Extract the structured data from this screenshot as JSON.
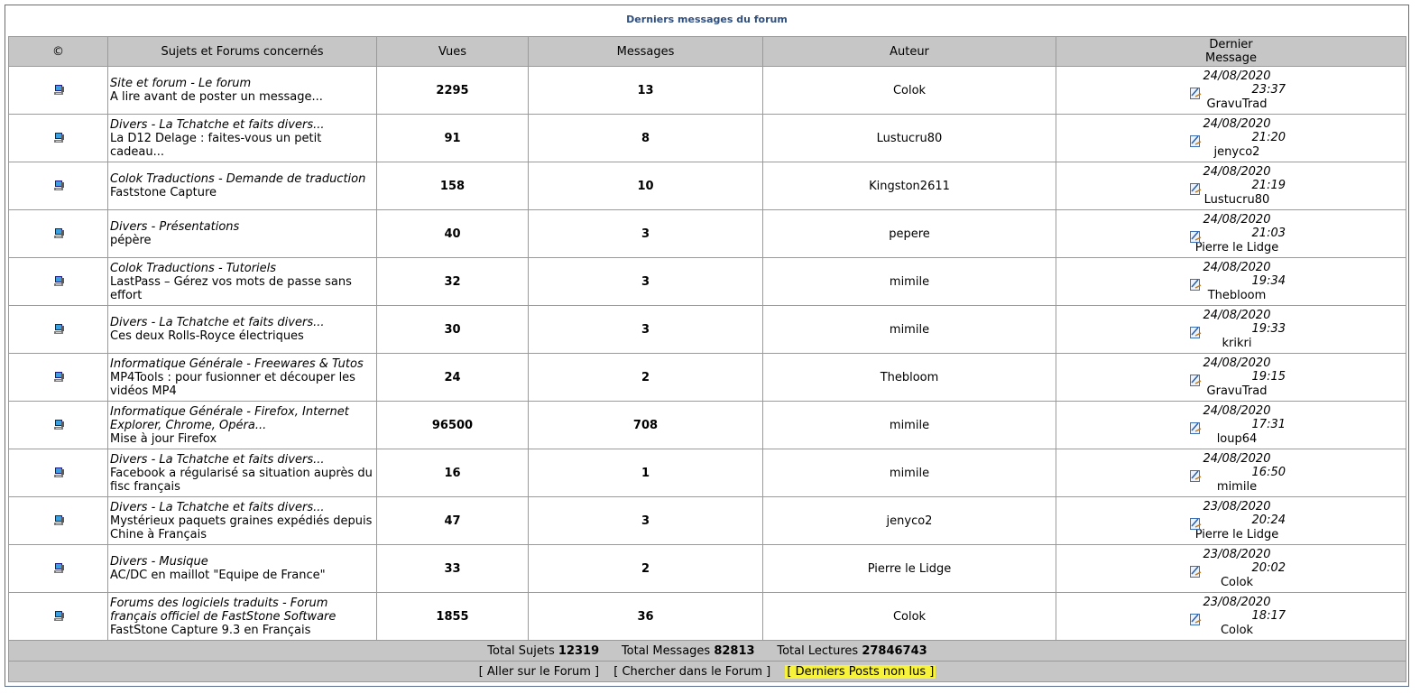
{
  "page_title": "Derniers messages du forum",
  "columns": [
    "©",
    "Sujets et Forums concernés",
    "Vues",
    "Messages",
    "Auteur",
    "Dernier\nMessage"
  ],
  "rows": [
    {
      "forum": "Site et forum - Le forum",
      "topic": "A lire avant de poster un message...",
      "views": "2295",
      "messages": "13",
      "author": "Colok",
      "date": "24/08/2020",
      "time": "23:37",
      "last_user": "GravuTrad"
    },
    {
      "forum": "Divers - La Tchatche et faits divers...",
      "topic": "La D12 Delage : faites-vous un petit cadeau...",
      "views": "91",
      "messages": "8",
      "author": "Lustucru80",
      "date": "24/08/2020",
      "time": "21:20",
      "last_user": "jenyco2"
    },
    {
      "forum": "Colok Traductions - Demande de traduction",
      "topic": "Faststone Capture",
      "views": "158",
      "messages": "10",
      "author": "Kingston2611",
      "date": "24/08/2020",
      "time": "21:19",
      "last_user": "Lustucru80"
    },
    {
      "forum": "Divers - Présentations",
      "topic": "pépère",
      "views": "40",
      "messages": "3",
      "author": "pepere",
      "date": "24/08/2020",
      "time": "21:03",
      "last_user": "Pierre le Lidge"
    },
    {
      "forum": "Colok Traductions - Tutoriels",
      "topic": "LastPass – Gérez vos mots de passe sans effort",
      "views": "32",
      "messages": "3",
      "author": "mimile",
      "date": "24/08/2020",
      "time": "19:34",
      "last_user": "Thebloom"
    },
    {
      "forum": "Divers - La Tchatche et faits divers...",
      "topic": "Ces deux Rolls-Royce électriques",
      "views": "30",
      "messages": "3",
      "author": "mimile",
      "date": "24/08/2020",
      "time": "19:33",
      "last_user": "krikri"
    },
    {
      "forum": "Informatique Générale - Freewares & Tutos",
      "topic": "MP4Tools : pour fusionner et découper les vidéos MP4",
      "views": "24",
      "messages": "2",
      "author": "Thebloom",
      "date": "24/08/2020",
      "time": "19:15",
      "last_user": "GravuTrad"
    },
    {
      "forum": "Informatique Générale - Firefox, Internet Explorer, Chrome, Opéra...",
      "topic": "Mise à jour Firefox",
      "views": "96500",
      "messages": "708",
      "author": "mimile",
      "date": "24/08/2020",
      "time": "17:31",
      "last_user": "loup64"
    },
    {
      "forum": "Divers - La Tchatche et faits divers...",
      "topic": "Facebook a régularisé sa situation auprès du fisc français",
      "views": "16",
      "messages": "1",
      "author": "mimile",
      "date": "24/08/2020",
      "time": "16:50",
      "last_user": "mimile"
    },
    {
      "forum": "Divers - La Tchatche et faits divers...",
      "topic": "Mystérieux paquets graines expédiés depuis Chine à Français",
      "views": "47",
      "messages": "3",
      "author": "jenyco2",
      "date": "23/08/2020",
      "time": "20:24",
      "last_user": "Pierre le Lidge"
    },
    {
      "forum": "Divers - Musique",
      "topic": "AC/DC en maillot \"Equipe de France\"",
      "views": "33",
      "messages": "2",
      "author": "Pierre le Lidge",
      "date": "23/08/2020",
      "time": "20:02",
      "last_user": "Colok"
    },
    {
      "forum": "Forums des logiciels traduits - Forum français officiel de FastStone Software",
      "topic": "FastStone Capture 9.3 en Français",
      "views": "1855",
      "messages": "36",
      "author": "Colok",
      "date": "23/08/2020",
      "time": "18:17",
      "last_user": "Colok"
    }
  ],
  "totals": {
    "sujets_label": "Total Sujets",
    "sujets": "12319",
    "messages_label": "Total Messages",
    "messages": "82813",
    "lectures_label": "Total Lectures",
    "lectures": "27846743"
  },
  "links": {
    "forum": "[ Aller sur le Forum ]",
    "search": "[ Chercher dans le Forum ]",
    "unread": "[ Derniers Posts non lus ]"
  },
  "colors": {
    "header_bg": "#c6c6c6",
    "title": "#2f4f7f",
    "highlight": "#f7f23a"
  }
}
